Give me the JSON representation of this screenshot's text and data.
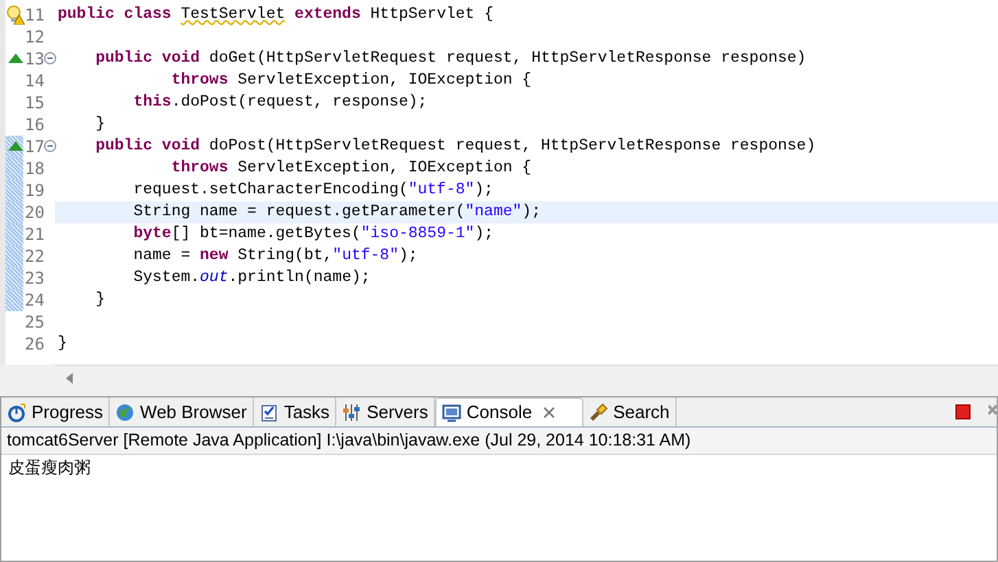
{
  "editor": {
    "lines": [
      {
        "number": "11",
        "warning": true,
        "override": false,
        "fold": false,
        "changed": false,
        "current": false,
        "tokens": [
          {
            "kind": "keyword",
            "text": "public class "
          },
          {
            "kind": "warn",
            "text": "TestServlet"
          },
          {
            "kind": "keyword",
            "text": " extends"
          },
          {
            "kind": "plain",
            "text": " HttpServlet {"
          }
        ]
      },
      {
        "number": "12",
        "warning": false,
        "override": false,
        "fold": false,
        "changed": false,
        "current": false
      },
      {
        "number": "13",
        "warning": false,
        "override": true,
        "fold": true,
        "changed": false,
        "current": false,
        "tokens": [
          {
            "kind": "keyword",
            "text": "    public void"
          },
          {
            "kind": "plain",
            "text": " doGet(HttpServletRequest request, HttpServletResponse response)"
          }
        ]
      },
      {
        "number": "14",
        "warning": false,
        "override": false,
        "fold": false,
        "changed": false,
        "current": false,
        "tokens": [
          {
            "kind": "keyword",
            "text": "            throws"
          },
          {
            "kind": "plain",
            "text": " ServletException, IOException {"
          }
        ]
      },
      {
        "number": "15",
        "warning": false,
        "override": false,
        "fold": false,
        "changed": false,
        "current": false,
        "tokens": [
          {
            "kind": "keyword",
            "text": "        this"
          },
          {
            "kind": "plain",
            "text": ".doPost(request, response);"
          }
        ]
      },
      {
        "number": "16",
        "warning": false,
        "override": false,
        "fold": false,
        "changed": false,
        "current": false,
        "tokens": [
          {
            "kind": "plain",
            "text": "    }"
          }
        ]
      },
      {
        "number": "17",
        "warning": false,
        "override": true,
        "fold": true,
        "changed": true,
        "current": false,
        "tokens": [
          {
            "kind": "keyword",
            "text": "    public void"
          },
          {
            "kind": "plain",
            "text": " doPost(HttpServletRequest request, HttpServletResponse response)"
          }
        ]
      },
      {
        "number": "18",
        "warning": false,
        "override": false,
        "fold": false,
        "changed": true,
        "current": false,
        "tokens": [
          {
            "kind": "keyword",
            "text": "            throws"
          },
          {
            "kind": "plain",
            "text": " ServletException, IOException {"
          }
        ]
      },
      {
        "number": "19",
        "warning": false,
        "override": false,
        "fold": false,
        "changed": true,
        "current": false,
        "tokens": [
          {
            "kind": "plain",
            "text": "        request.setCharacterEncoding("
          },
          {
            "kind": "string",
            "text": "\"utf-8\""
          },
          {
            "kind": "plain",
            "text": ");"
          }
        ]
      },
      {
        "number": "20",
        "warning": false,
        "override": false,
        "fold": false,
        "changed": true,
        "current": true,
        "tokens": [
          {
            "kind": "plain",
            "text": "        String name = request.getParameter("
          },
          {
            "kind": "string",
            "text": "\"name\""
          },
          {
            "kind": "plain",
            "text": ");"
          }
        ]
      },
      {
        "number": "21",
        "warning": false,
        "override": false,
        "fold": false,
        "changed": true,
        "current": false,
        "tokens": [
          {
            "kind": "keyword",
            "text": "        byte"
          },
          {
            "kind": "plain",
            "text": "[] bt=name.getBytes("
          },
          {
            "kind": "string",
            "text": "\"iso-8859-1\""
          },
          {
            "kind": "plain",
            "text": ");"
          }
        ]
      },
      {
        "number": "22",
        "warning": false,
        "override": false,
        "fold": false,
        "changed": true,
        "current": false,
        "tokens": [
          {
            "kind": "plain",
            "text": "        name = "
          },
          {
            "kind": "keyword",
            "text": "new"
          },
          {
            "kind": "plain",
            "text": " String(bt,"
          },
          {
            "kind": "string",
            "text": "\"utf-8\""
          },
          {
            "kind": "plain",
            "text": ");"
          }
        ]
      },
      {
        "number": "23",
        "warning": false,
        "override": false,
        "fold": false,
        "changed": true,
        "current": false,
        "tokens": [
          {
            "kind": "plain",
            "text": "        System."
          },
          {
            "kind": "static",
            "text": "out"
          },
          {
            "kind": "plain",
            "text": ".println(name);"
          }
        ]
      },
      {
        "number": "24",
        "warning": false,
        "override": false,
        "fold": false,
        "changed": true,
        "current": false,
        "tokens": [
          {
            "kind": "plain",
            "text": "    }"
          }
        ]
      },
      {
        "number": "25",
        "warning": false,
        "override": false,
        "fold": false,
        "changed": false,
        "current": false
      },
      {
        "number": "26",
        "warning": false,
        "override": false,
        "fold": false,
        "changed": false,
        "current": false,
        "tokens": [
          {
            "kind": "plain",
            "text": "}"
          }
        ]
      }
    ]
  },
  "tabs": [
    {
      "label": "Progress",
      "kind": "progress",
      "selected": false,
      "closable": false
    },
    {
      "label": "Web Browser",
      "kind": "browser",
      "selected": false,
      "closable": false
    },
    {
      "label": "Tasks",
      "kind": "tasks",
      "selected": false,
      "closable": false
    },
    {
      "label": "Servers",
      "kind": "servers",
      "selected": false,
      "closable": false
    },
    {
      "label": "Console",
      "kind": "console",
      "selected": true,
      "closable": true
    },
    {
      "label": "Search",
      "kind": "search",
      "selected": false,
      "closable": false
    }
  ],
  "console": {
    "header": "tomcat6Server [Remote Java Application] I:\\java\\bin\\javaw.exe (Jul 29, 2014 10:18:31 AM)",
    "output": [
      "皮蛋瘦肉粥"
    ]
  }
}
